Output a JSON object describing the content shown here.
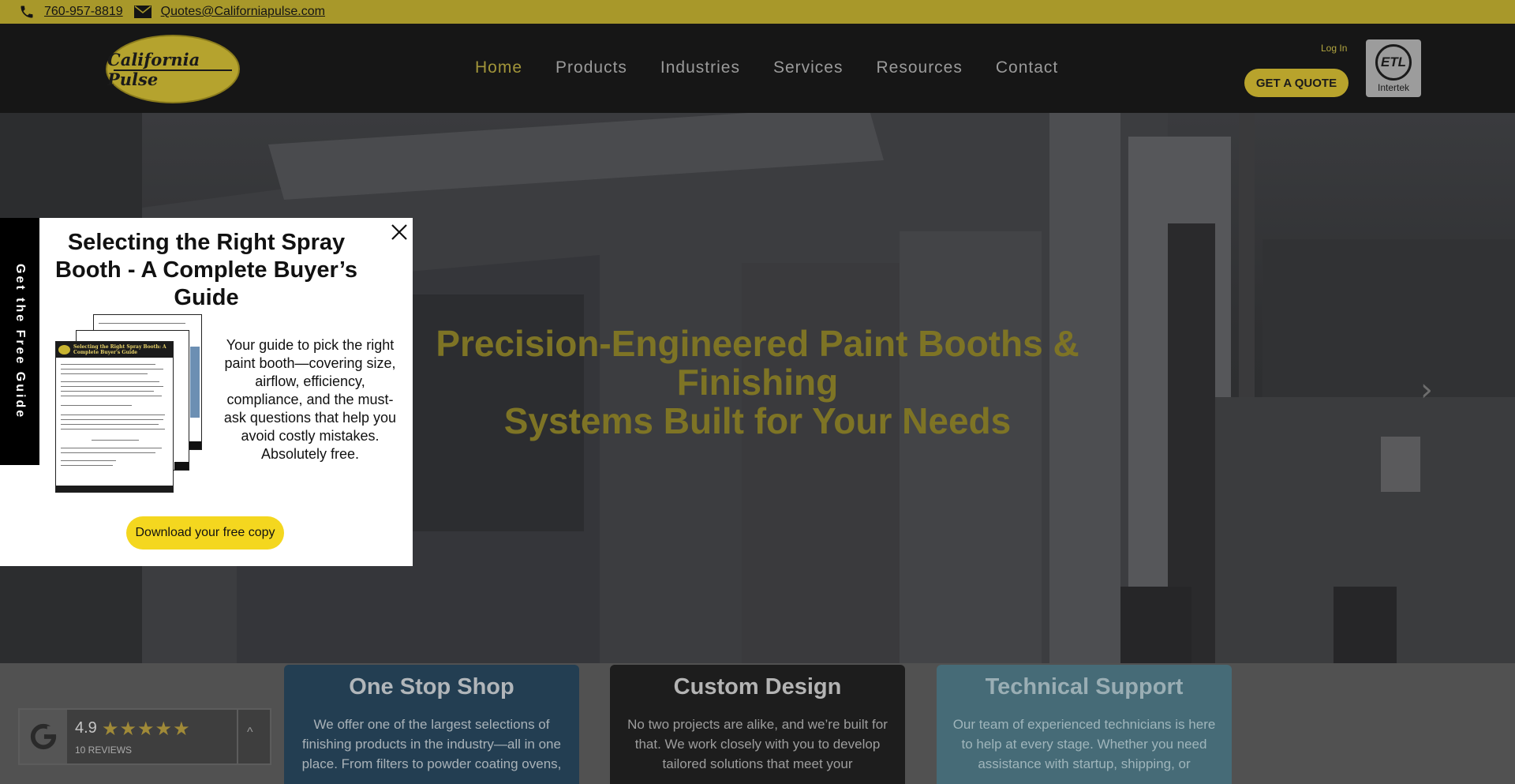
{
  "topbar": {
    "phone": "760-957-8819",
    "email": "Quotes@Californiapulse.com",
    "phone_icon": "phone-icon",
    "email_icon": "envelope-icon"
  },
  "header": {
    "logo_text": "California Pulse",
    "nav": [
      {
        "label": "Home",
        "active": true
      },
      {
        "label": "Products",
        "active": false
      },
      {
        "label": "Industries",
        "active": false
      },
      {
        "label": "Services",
        "active": false
      },
      {
        "label": "Resources",
        "active": false
      },
      {
        "label": "Contact",
        "active": false
      }
    ],
    "login_label": "Log In",
    "quote_button": "GET A QUOTE",
    "cert_mark": "ETL",
    "cert_label": "Intertek"
  },
  "hero": {
    "title_line1": "Precision-Engineered Paint Booths & Finishing",
    "title_line2": "Systems Built for Your Needs",
    "next_arrow": "›"
  },
  "side_tab": {
    "label": "Get the Free Guide"
  },
  "popup": {
    "title": "Selecting the Right Spray Booth - A Complete Buyer’s Guide",
    "description": "Your guide to pick the right paint booth—covering size, airflow, efficiency, compliance, and the must-ask questions that help you avoid costly mistakes. Absolutely free.",
    "button": "Download your free copy",
    "doc_header": "Selecting the Right Spray Booth: A Complete Buyer's Guide"
  },
  "features": [
    {
      "title": "One Stop Shop",
      "text": "We offer one of the largest selections of finishing products in the industry—all in one place. From filters to powder coating ovens,"
    },
    {
      "title": "Custom Design",
      "text": "No two projects are alike, and we’re built for that. We work closely with you to develop tailored solutions that meet your"
    },
    {
      "title": "Technical Support",
      "text": "Our team of experienced technicians is here to help at every stage. Whether you need assistance with startup, shipping, or"
    }
  ],
  "review": {
    "rating": "4.9",
    "stars": "★★★★★",
    "count": "10 REVIEWS",
    "caret": "^"
  },
  "colors": {
    "accent": "#b8a32c",
    "popup_button": "#f4d71f"
  }
}
